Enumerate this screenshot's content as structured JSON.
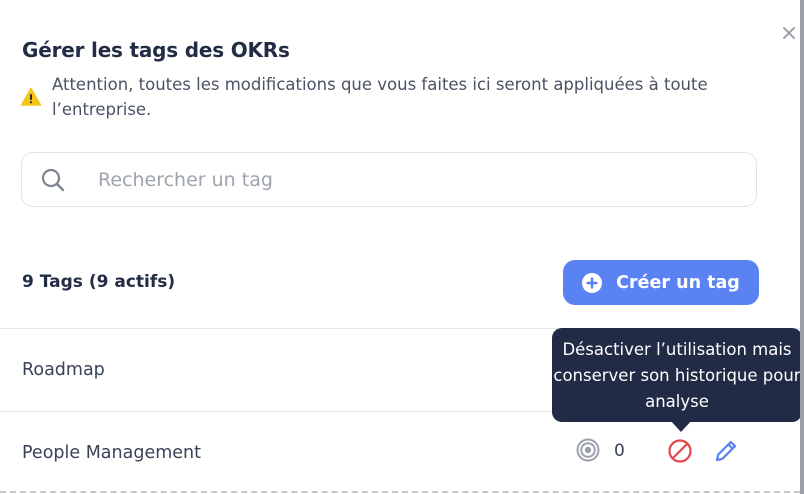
{
  "modal": {
    "title": "Gérer les tags des OKRs",
    "warning": "Attention, toutes les modifications que vous faites ici seront appliquées à toute l’entreprise.",
    "close_icon": "close-icon",
    "warning_icon": "warning-icon"
  },
  "search": {
    "placeholder": "Rechercher un tag",
    "value": "",
    "icon": "search-icon"
  },
  "summary": {
    "count_label": "9 Tags (9 actifs)"
  },
  "create_button": {
    "label": "Créer un tag",
    "icon": "plus-circle-icon"
  },
  "tags": [
    {
      "name": "Roadmap"
    },
    {
      "name": "People Management",
      "usage_count": "0"
    }
  ],
  "row_actions": {
    "usage_icon": "target-icon",
    "deactivate_icon": "ban-icon",
    "edit_icon": "pencil-icon"
  },
  "tooltip": {
    "text": "Désactiver l’utilisation mais conserver son historique pour analyse"
  },
  "colors": {
    "primary": "#5b82f2",
    "title": "#232c45",
    "warning": "#f5c518",
    "danger": "#e0484d",
    "tooltip_bg": "#222b45"
  }
}
